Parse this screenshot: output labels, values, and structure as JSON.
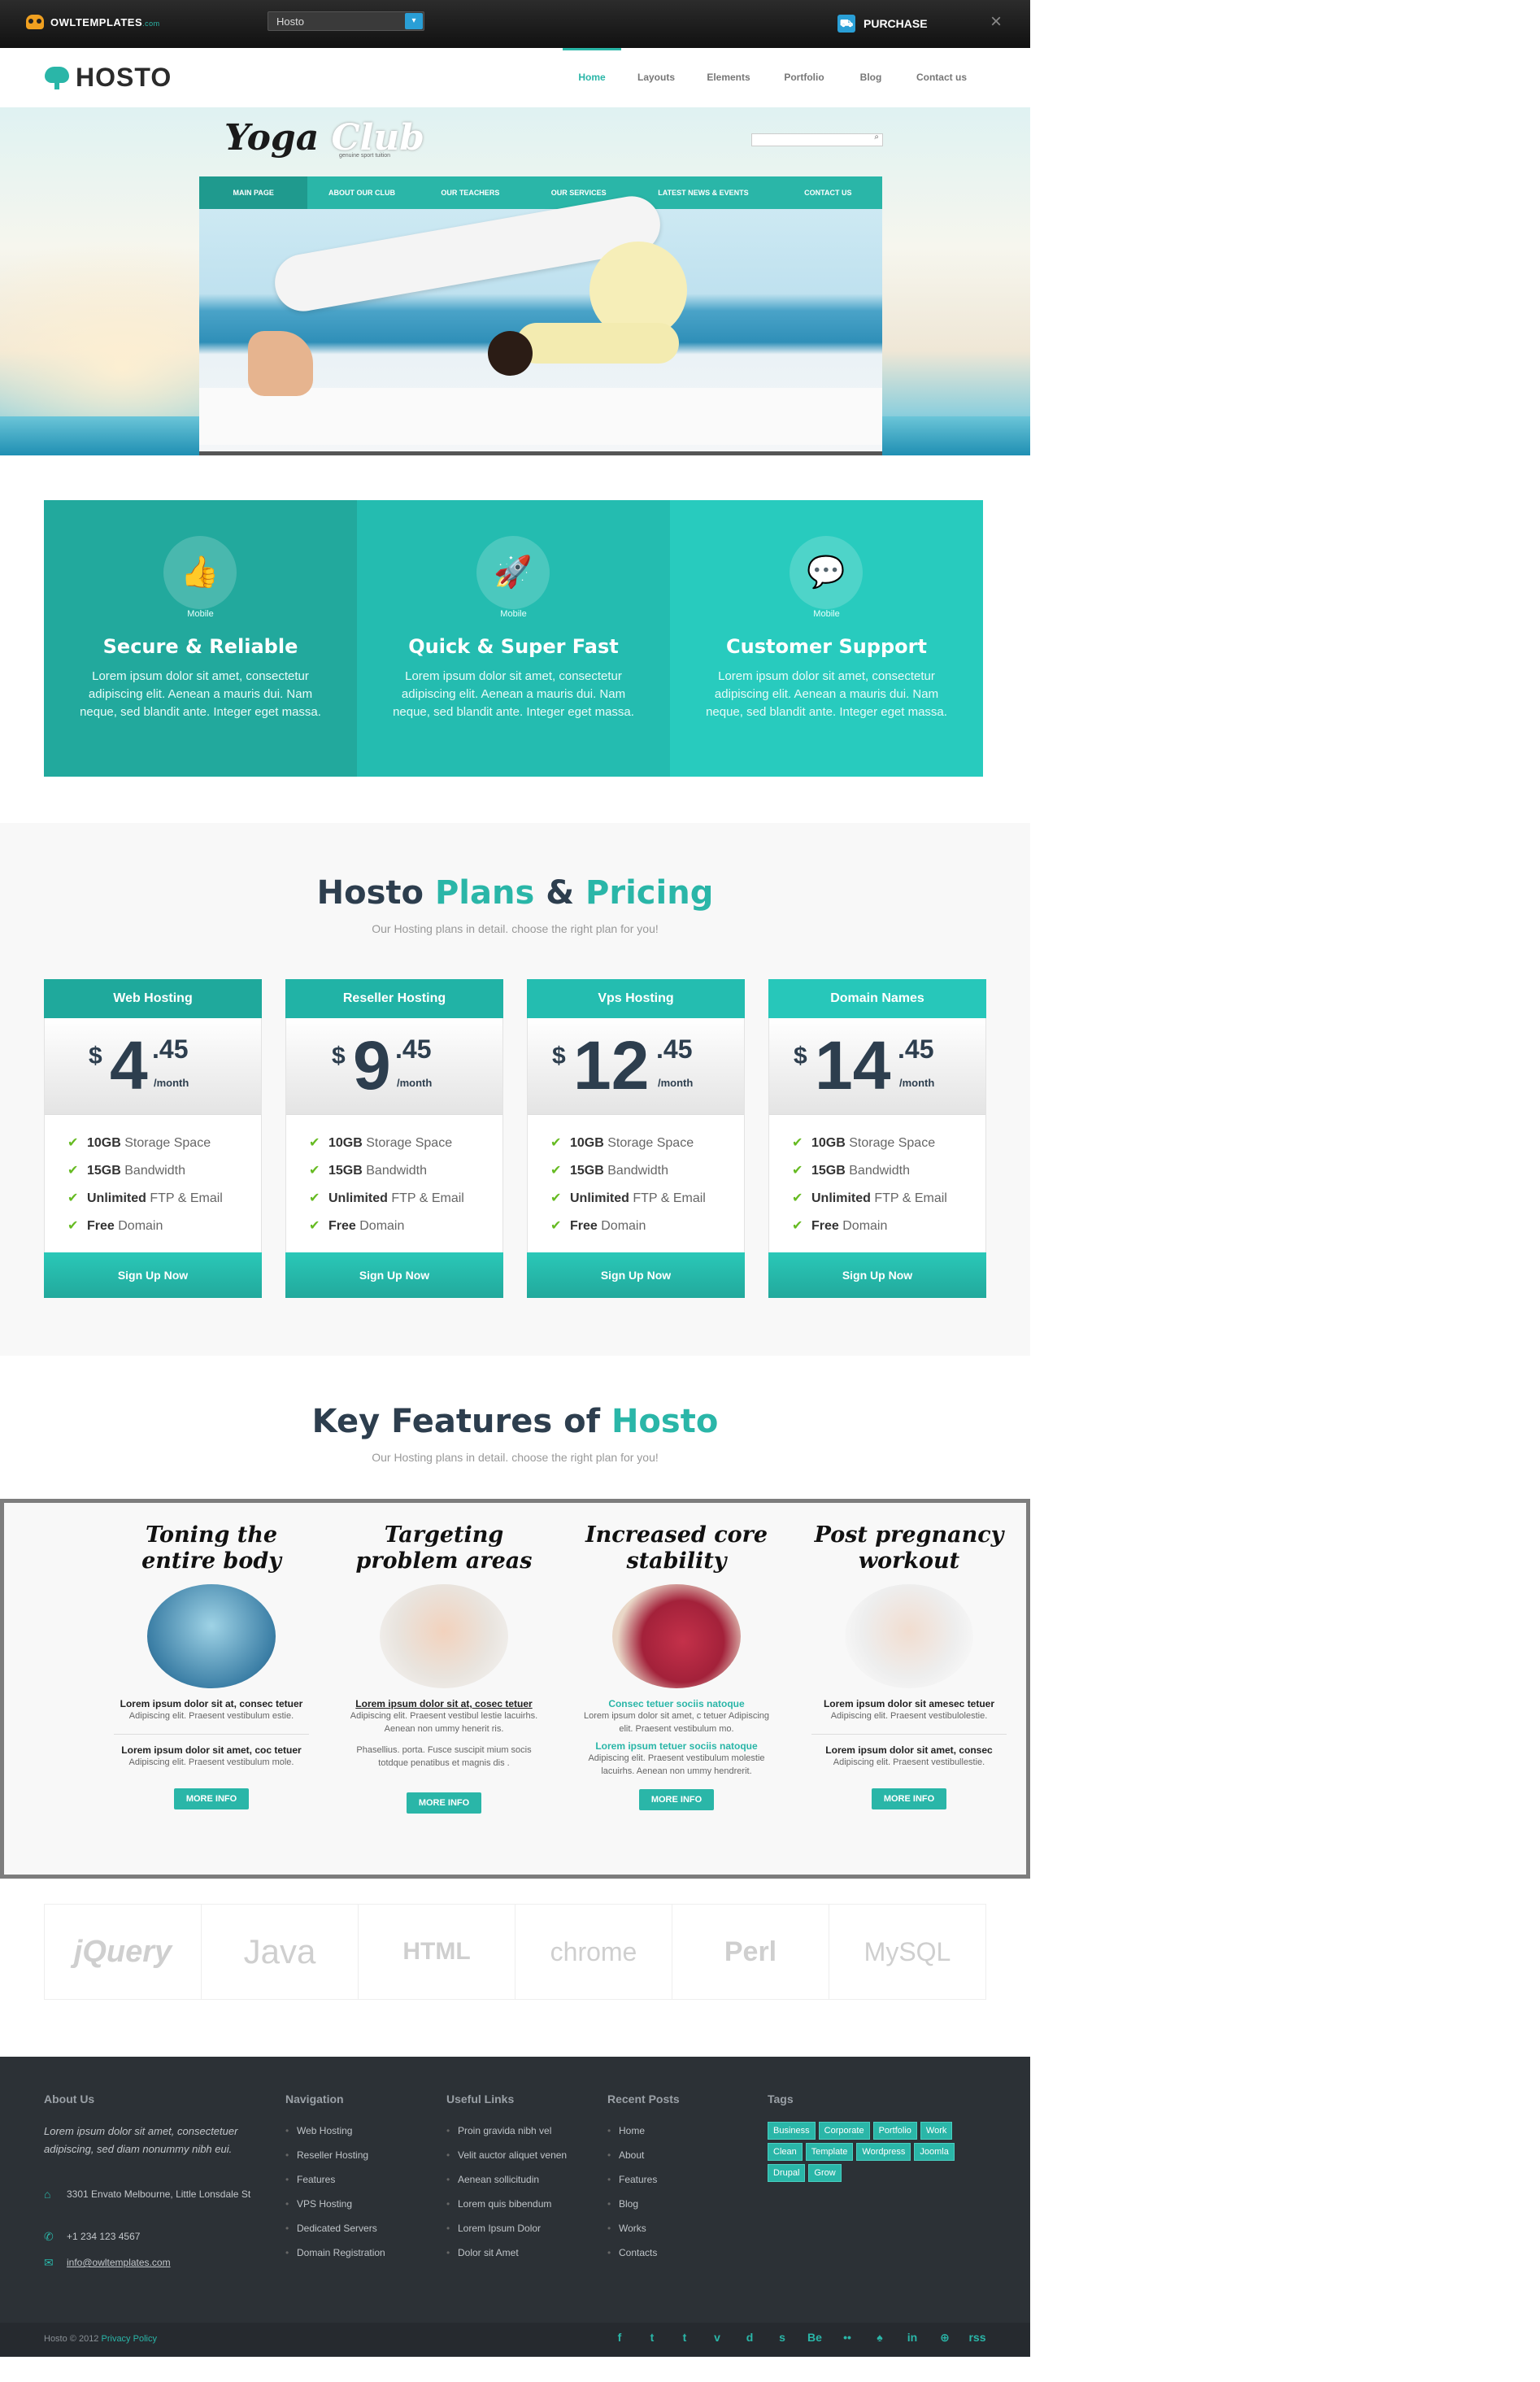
{
  "topbar": {
    "brand": "OWLTEMPLATES",
    "brand_suffix": ".com",
    "select_value": "Hosto",
    "purchase": "PURCHASE",
    "close": "×"
  },
  "header": {
    "brand": "HOSTO",
    "nav": [
      "Home",
      "Layouts",
      "Elements",
      "Portfolio",
      "Blog",
      "Contact us"
    ]
  },
  "hero": {
    "title_dark": "Yoga",
    "title_light": "Club",
    "subtitle": "genuine sport tuition",
    "nav": [
      "MAIN PAGE",
      "ABOUT OUR CLUB",
      "OUR TEACHERS",
      "OUR SERVICES",
      "LATEST NEWS & EVENTS",
      "CONTACT US"
    ]
  },
  "features": [
    {
      "icon": "thumbs-up-icon",
      "glyph": "👍",
      "label": "Mobile",
      "title": "Secure & Reliable",
      "desc": "Lorem ipsum dolor sit amet, consectetur adipiscing elit. Aenean a mauris dui. Nam neque, sed blandit ante. Integer eget massa.",
      "color": "#22a99d"
    },
    {
      "icon": "rocket-icon",
      "glyph": "🚀",
      "label": "Mobile",
      "title": "Quick & Super Fast",
      "desc": "Lorem ipsum dolor sit amet, consectetur adipiscing elit. Aenean a mauris dui. Nam neque, sed blandit ante. Integer eget massa.",
      "color": "#24bcb0"
    },
    {
      "icon": "chat-icon",
      "glyph": "💬",
      "label": "Mobile",
      "title": "Customer Support",
      "desc": "Lorem ipsum dolor sit amet, consectetur adipiscing elit. Aenean a mauris dui. Nam neque, sed blandit ante. Integer eget massa.",
      "color": "#28cbbe"
    }
  ],
  "pricing": {
    "h_a": "Hosto",
    "h_b": "Plans",
    "h_c": "&",
    "h_d": "Pricing",
    "sub": "Our Hosting plans in detail. choose the right plan for you!",
    "plans": [
      {
        "name": "Web Hosting",
        "currency": "$",
        "dollars": "4",
        "cents": ".45",
        "per": "/month",
        "color": "#1fa99c",
        "button": "Sign Up Now"
      },
      {
        "name": "Reseller Hosting",
        "currency": "$",
        "dollars": "9",
        "cents": ".45",
        "per": "/month",
        "color": "#21b3a6",
        "button": "Sign Up Now"
      },
      {
        "name": "Vps Hosting",
        "currency": "$",
        "dollars": "12",
        "cents": ".45",
        "per": "/month",
        "color": "#24bdb0",
        "button": "Sign Up Now"
      },
      {
        "name": "Domain Names",
        "currency": "$",
        "dollars": "14",
        "cents": ".45",
        "per": "/month",
        "color": "#27c7ba",
        "button": "Sign Up Now"
      }
    ],
    "items": [
      {
        "bold": "10GB",
        "rest": " Storage Space"
      },
      {
        "bold": "15GB",
        "rest": " Bandwidth"
      },
      {
        "bold": "Unlimited",
        "rest": " FTP & Email"
      },
      {
        "bold": "Free",
        "rest": " Domain"
      }
    ]
  },
  "key": {
    "h_a": "Key Features of",
    "h_b": "Hosto",
    "sub": "Our Hosting plans in detail. choose the right plan for you!",
    "cols": [
      {
        "title": "Toning the entire body",
        "l1": "Lorem ipsum dolor sit at, consec tetuer",
        "l2": "Adipiscing elit. Praesent vestibulum estie.",
        "l3": "Lorem ipsum dolor sit amet, coc tetuer",
        "l4": "Adipiscing elit. Praesent vestibulum mole.",
        "btn": "MORE INFO"
      },
      {
        "title": "Targeting problem areas",
        "l1": "Lorem ipsum dolor sit at, cosec tetuer",
        "l2": "Adipiscing elit. Praesent vestibul lestie lacuirhs. Aenean non ummy henerit ris.",
        "l3": "",
        "l4": "Phasellius. porta. Fusce suscipit mium socis totdque penatibus et magnis dis .",
        "btn": "MORE INFO"
      },
      {
        "title": "Increased core stability",
        "l1": "Consec tetuer sociis natoque",
        "l2": "Lorem ipsum dolor sit amet, c tetuer Adipiscing elit. Praesent vestibulum mo.",
        "l3": "Lorem ipsum tetuer sociis natoque",
        "l4": "Adipiscing elit. Praesent vestibulum molestie lacuirhs. Aenean non ummy hendrerit.",
        "btn": "MORE INFO"
      },
      {
        "title": "Post pregnancy workout",
        "l1": "Lorem ipsum dolor sit amesec tetuer",
        "l2": "Adipiscing elit. Praesent vestibulolestie.",
        "l3": "Lorem ipsum dolor sit amet, consec",
        "l4": "Adipiscing elit. Praesent vestibullestie.",
        "btn": "MORE INFO"
      }
    ]
  },
  "logos": [
    "jQuery",
    "Java",
    "HTML",
    "chrome",
    "Perl",
    "MySQL"
  ],
  "footer": {
    "about_h": "About Us",
    "about": "Lorem ipsum dolor sit amet, consectetuer adipiscing, sed diam nonummy nibh eui.",
    "address": "3301 Envato Melbourne, Little Lonsdale St",
    "phone": "+1 234 123 4567",
    "email": "info@owltemplates.com",
    "nav_h": "Navigation",
    "nav": [
      "Web Hosting",
      "Reseller Hosting",
      "Features",
      "VPS Hosting",
      "Dedicated Servers",
      "Domain Registration"
    ],
    "links_h": "Useful Links",
    "links": [
      "Proin gravida nibh vel",
      "Velit auctor aliquet venen",
      "Aenean sollicitudin",
      "Lorem quis bibendum",
      "Lorem Ipsum Dolor",
      "Dolor sit Amet"
    ],
    "posts_h": "Recent Posts",
    "posts": [
      "Home",
      "About",
      "Features",
      "Blog",
      "Works",
      "Contacts"
    ],
    "tags_h": "Tags",
    "tags": [
      "Business",
      "Corporate",
      "Portfolio",
      "Work",
      "Clean",
      "Template",
      "Wordpress",
      "Joomla",
      "Drupal",
      "Grow"
    ],
    "copy": "Hosto © 2012",
    "privacy": "Privacy Policy",
    "social": [
      "f",
      "t",
      "t",
      "v",
      "d",
      "s",
      "Be",
      "••",
      "♠",
      "in",
      "⊕",
      "rss"
    ]
  }
}
